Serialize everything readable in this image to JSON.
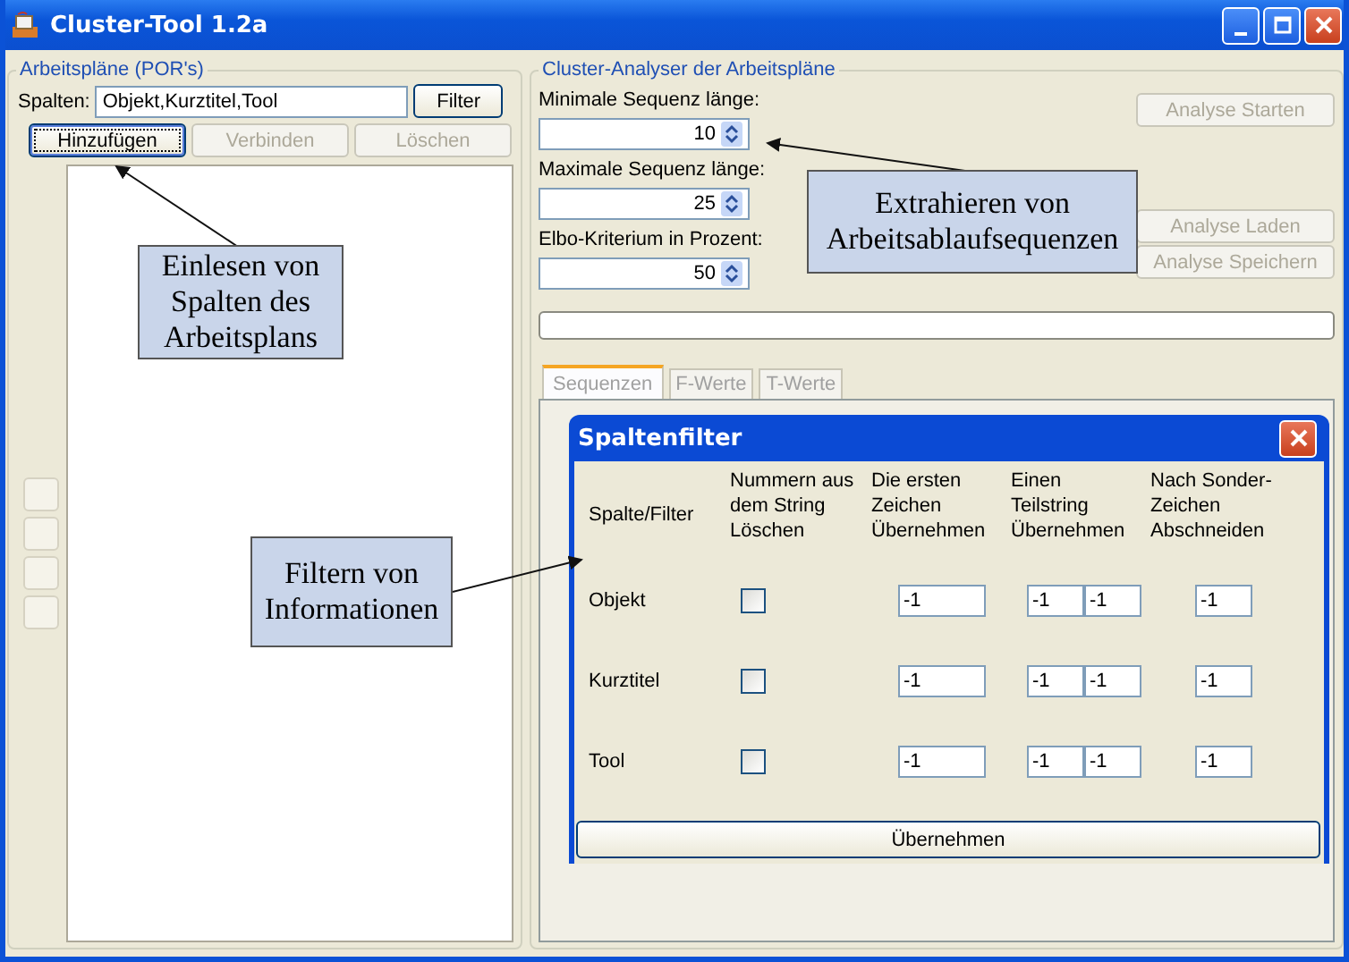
{
  "window": {
    "title": "Cluster-Tool 1.2a"
  },
  "left_panel": {
    "title": "Arbeitspläne (POR's)",
    "columns_label": "Spalten:",
    "columns_value": "Objekt,Kurztitel,Tool",
    "filter_button": "Filter",
    "buttons": [
      {
        "label": "Hinzufügen",
        "disabled": false,
        "focused": true
      },
      {
        "label": "Verbinden",
        "disabled": true,
        "focused": false
      },
      {
        "label": "Löschen",
        "disabled": true,
        "focused": false
      }
    ]
  },
  "right_panel": {
    "title": "Cluster-Analyser der Arbeitspläne",
    "spinners": [
      {
        "label": "Minimale Sequenz länge:",
        "value": "10"
      },
      {
        "label": "Maximale Sequenz länge:",
        "value": "25"
      },
      {
        "label": "Elbo-Kriterium in Prozent:",
        "value": "50"
      }
    ],
    "buttons": [
      {
        "label": "Analyse Starten",
        "disabled": true
      },
      {
        "label": "Analyse Laden",
        "disabled": true
      },
      {
        "label": "Analyse Speichern",
        "disabled": true
      }
    ],
    "progress": {
      "level": 0
    },
    "tabs": [
      {
        "label": "Sequenzen",
        "selected": true
      },
      {
        "label": "F-Werte",
        "selected": false
      },
      {
        "label": "T-Werte",
        "selected": false
      }
    ]
  },
  "dialog": {
    "title": "Spaltenfilter",
    "headers": [
      "Spalte/Filter",
      "Nummern aus\ndem String\nLöschen",
      "Die ersten\nZeichen\nÜbernehmen",
      "Einen\nTeilstring\nÜbernehmen",
      "Nach Sonder-\nZeichen\nAbschneiden"
    ],
    "rows": [
      {
        "name": "Objekt",
        "checked": false,
        "first_chars": "-1",
        "substring_start": "-1",
        "substring_end": "-1",
        "cut_after": "-1"
      },
      {
        "name": "Kurztitel",
        "checked": false,
        "first_chars": "-1",
        "substring_start": "-1",
        "substring_end": "-1",
        "cut_after": "-1"
      },
      {
        "name": "Tool",
        "checked": false,
        "first_chars": "-1",
        "substring_start": "-1",
        "substring_end": "-1",
        "cut_after": "-1"
      }
    ],
    "apply_button": "Übernehmen"
  },
  "annotations": [
    {
      "text": "Einlesen von\nSpalten des\nArbeitsplans"
    },
    {
      "text": "Extrahieren von\nArbeitsablaufsequenzen"
    },
    {
      "text": "Filtern von\nInformationen"
    }
  ]
}
